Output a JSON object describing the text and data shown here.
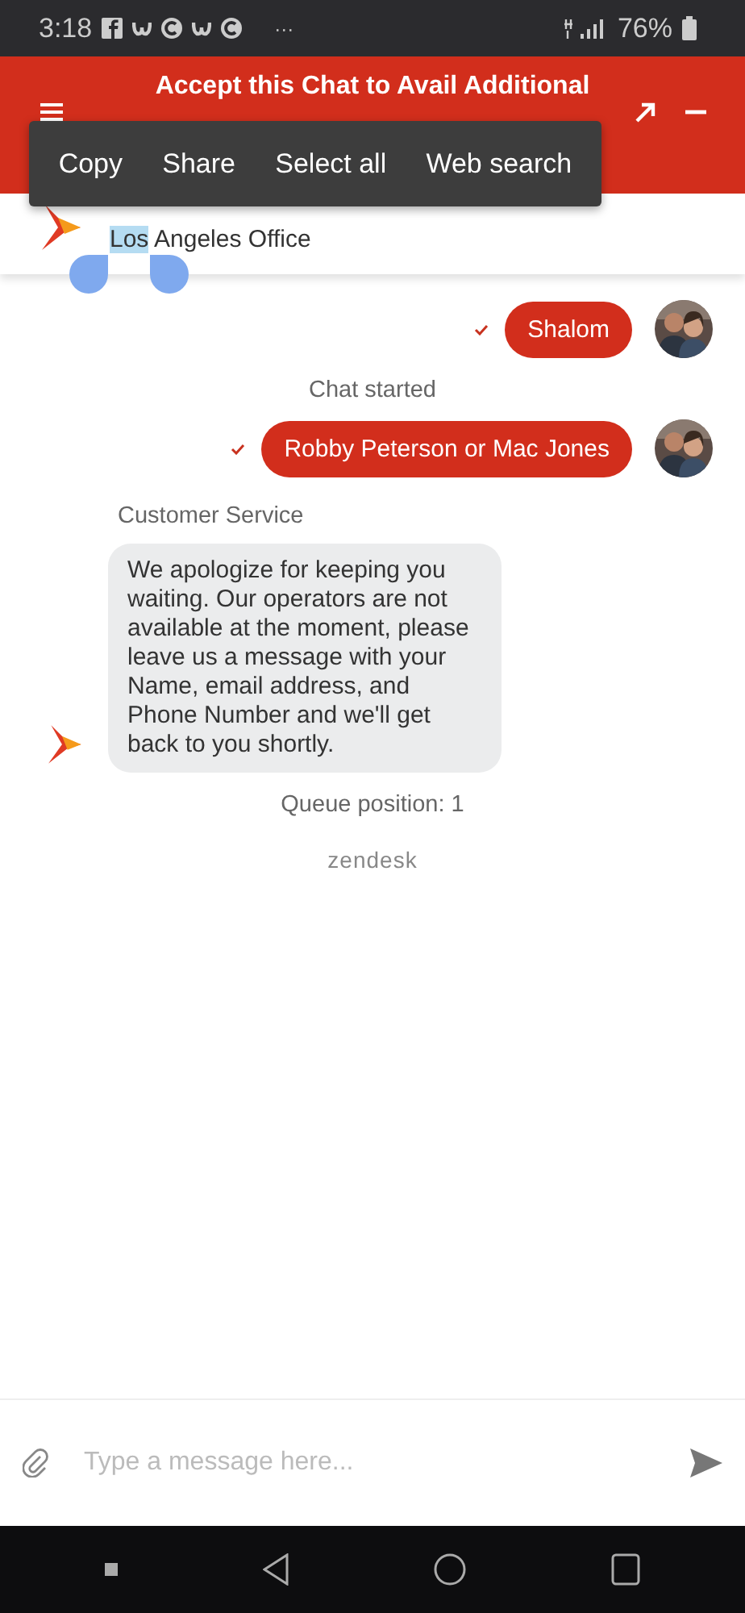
{
  "status_bar": {
    "time": "3:18",
    "more": "···",
    "battery": "76%"
  },
  "header": {
    "title": "Accept this Chat to Avail Additional"
  },
  "context_menu": {
    "items": [
      "Copy",
      "Share",
      "Select all",
      "Web search"
    ]
  },
  "company": {
    "subtitle_selected": "Los",
    "subtitle_rest": "Angeles Office"
  },
  "messages": [
    {
      "kind": "sent",
      "text": "Shalom"
    },
    {
      "kind": "notice",
      "text": "Chat started"
    },
    {
      "kind": "sent",
      "text": "Robby Peterson or Mac Jones"
    },
    {
      "kind": "sender",
      "text": "Customer Service"
    },
    {
      "kind": "received",
      "text": "We apologize for keeping you waiting. Our operators are not available at the moment, please leave us a message with your Name, email address, and Phone Number and we'll get back to you shortly."
    },
    {
      "kind": "notice",
      "text": "Queue position: 1"
    },
    {
      "kind": "brand",
      "text": "zendesk"
    }
  ],
  "composer": {
    "placeholder": "Type a message here..."
  }
}
